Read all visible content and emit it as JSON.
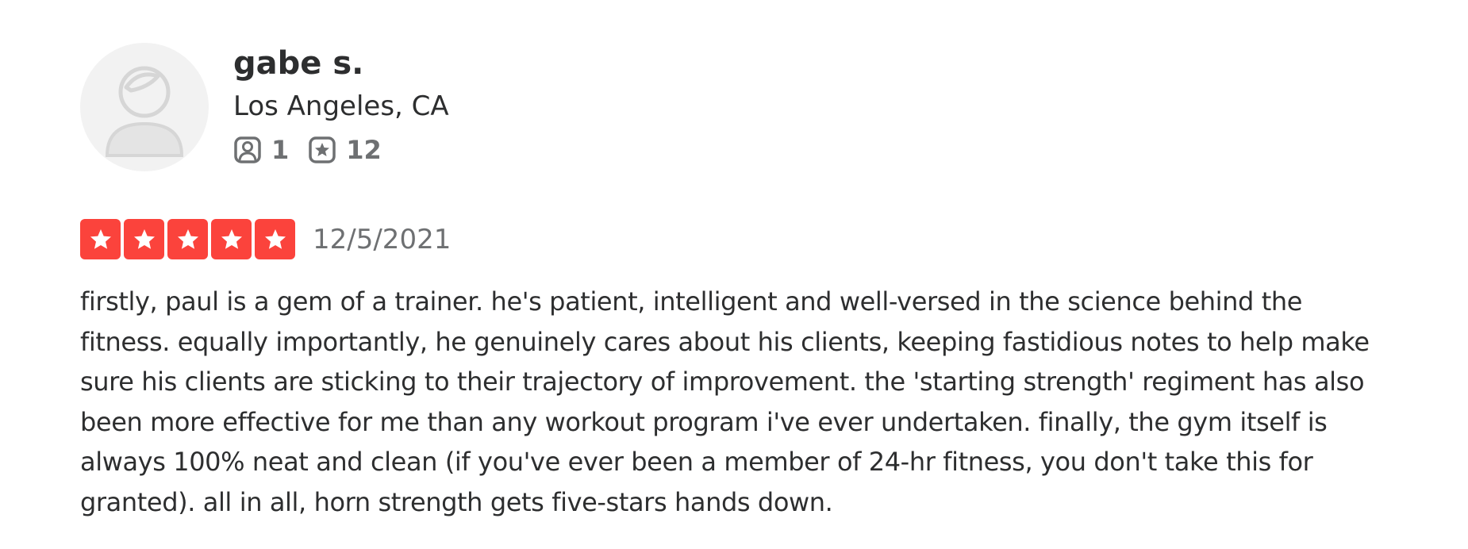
{
  "user": {
    "name": "gabe s.",
    "location": "Los Angeles, CA",
    "friends_count": "1",
    "reviews_count": "12",
    "friends_icon": "friends-icon",
    "reviews_icon": "star-review-icon"
  },
  "review": {
    "rating": 5,
    "rating_max": 5,
    "date": "12/5/2021",
    "star_color": "#fb433c",
    "text": "firstly, paul is a gem of a trainer. he's patient, intelligent and well-versed in the science behind the fitness. equally importantly, he genuinely cares about his clients, keeping fastidious notes to help make sure his clients are sticking to their trajectory of improvement. the 'starting strength' regiment has also been more effective for me than any workout program i've ever undertaken. finally, the gym itself is always 100% neat and clean (if you've ever been a member of 24-hr fitness, you don't take this for granted). all in all, horn strength gets five-stars hands down."
  }
}
